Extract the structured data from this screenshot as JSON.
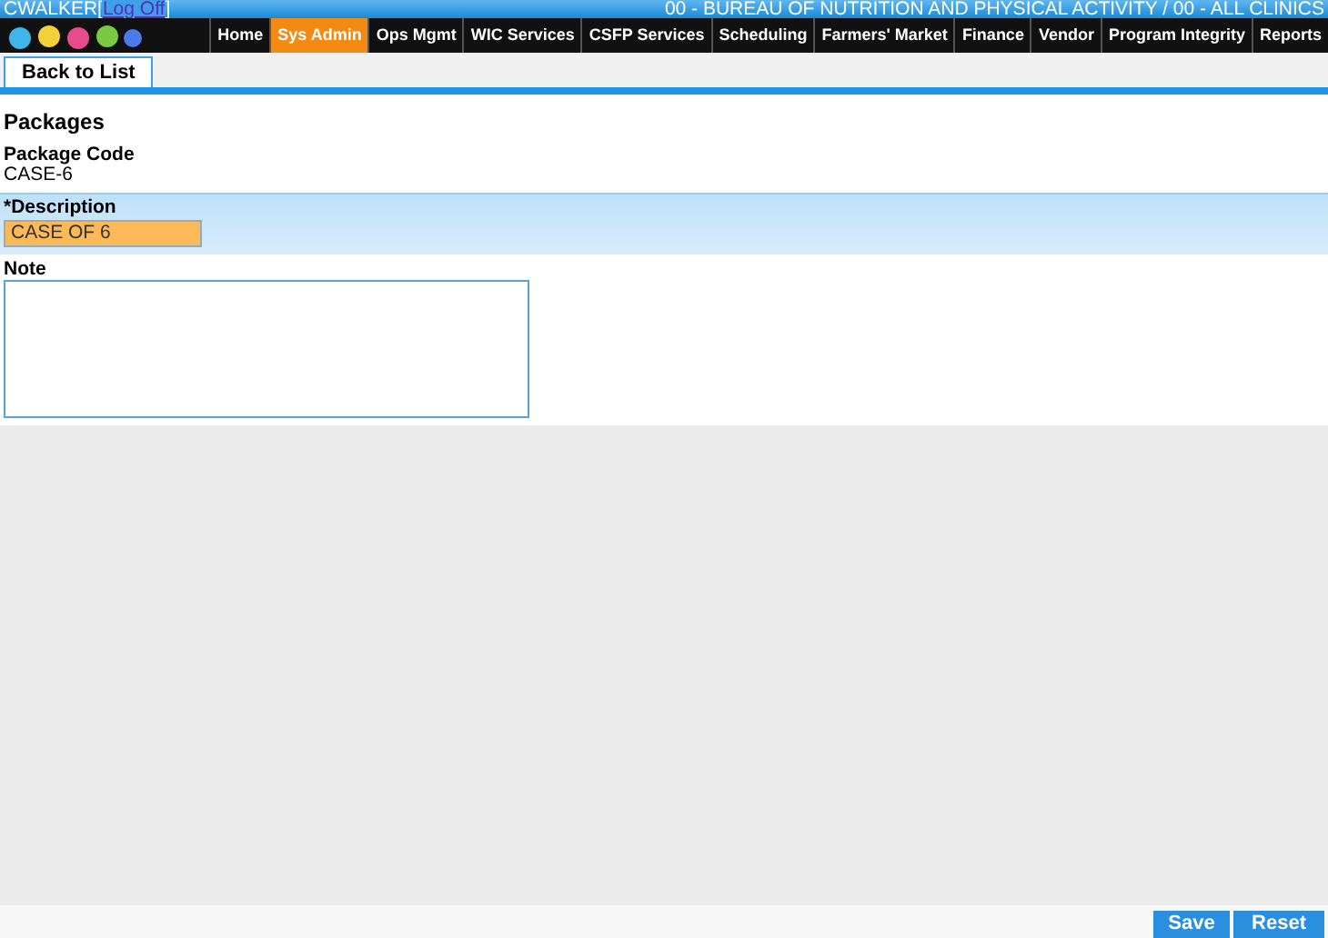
{
  "header": {
    "user": "CWALKER",
    "bracket_open": "[",
    "logoff_link": "Log Off",
    "bracket_close": "]",
    "location": "00 - BUREAU OF NUTRITION AND PHYSICAL ACTIVITY / 00 - ALL CLINICS"
  },
  "nav": [
    {
      "label": "Home",
      "selected": false
    },
    {
      "label": "Sys Admin",
      "selected": true
    },
    {
      "label": "Ops Mgmt",
      "selected": false
    },
    {
      "label": "WIC Services",
      "selected": false
    },
    {
      "label": "CSFP Services",
      "selected": false
    },
    {
      "label": "Scheduling",
      "selected": false
    },
    {
      "label": "Farmers' Market",
      "selected": false
    },
    {
      "label": "Finance",
      "selected": false
    },
    {
      "label": "Vendor",
      "selected": false
    },
    {
      "label": "Program Integrity",
      "selected": false
    },
    {
      "label": "Reports",
      "selected": false
    }
  ],
  "toolbar": {
    "back_button": "Back to List"
  },
  "form": {
    "title": "Packages",
    "package_code": {
      "label": "Package Code",
      "value": "CASE-6"
    },
    "description": {
      "label": "*Description",
      "value": "CASE OF 6"
    },
    "note": {
      "label": "Note"
    }
  },
  "footer": {
    "buttons": [
      "Save",
      "Reset"
    ]
  }
}
